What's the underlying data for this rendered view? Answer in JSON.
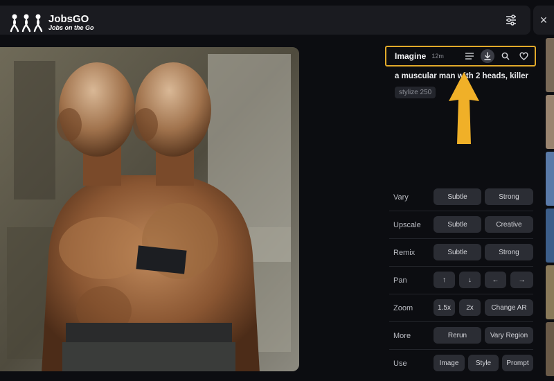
{
  "brand": {
    "name": "JobsGO",
    "tagline": "Jobs on the Go"
  },
  "toolbar": {
    "settings_icon": "sliders-icon",
    "close_label": "×"
  },
  "job": {
    "model": "Imagine",
    "age": "12m",
    "prompt": "a muscular man with 2 heads, killer",
    "param": "stylize 250",
    "header_icons": [
      "menu-icon",
      "download-icon",
      "search-icon",
      "heart-icon"
    ]
  },
  "actions": [
    {
      "label": "Vary",
      "buttons": [
        "Subtle",
        "Strong"
      ]
    },
    {
      "label": "Upscale",
      "buttons": [
        "Subtle",
        "Creative"
      ]
    },
    {
      "label": "Remix",
      "buttons": [
        "Subtle",
        "Strong"
      ]
    },
    {
      "label": "Pan",
      "buttons": [
        "↑",
        "↓",
        "←",
        "→"
      ]
    },
    {
      "label": "Zoom",
      "buttons": [
        "1.5x",
        "2x",
        "Change AR"
      ]
    },
    {
      "label": "More",
      "buttons": [
        "Rerun",
        "Vary Region"
      ]
    },
    {
      "label": "Use",
      "buttons": [
        "Image",
        "Style",
        "Prompt"
      ]
    }
  ],
  "colors": {
    "highlight": "#e2aa2a",
    "arrow": "#f0b028",
    "button_bg": "#2b2d34",
    "panel_bg": "#0c0d11"
  }
}
